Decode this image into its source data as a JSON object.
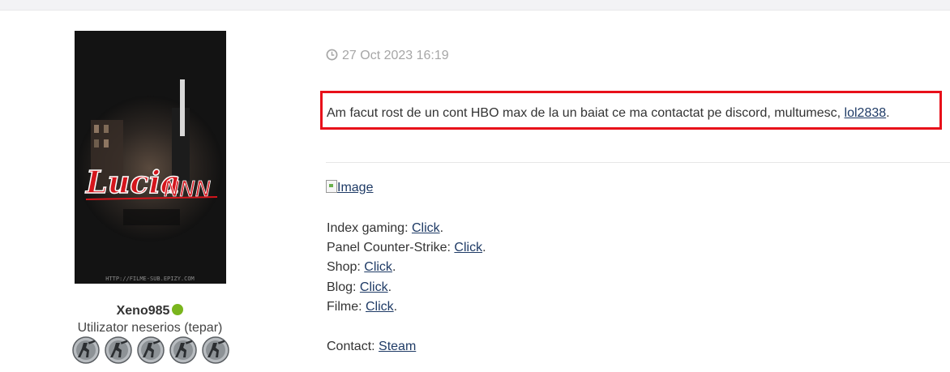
{
  "profile": {
    "avatar_text": "Lucia",
    "avatar_text_2": "NNN",
    "avatar_watermark": "HTTP://FILME-SUB.EPIZY.COM",
    "username": "Xeno985",
    "rank": "Utilizator neserios (tepar)",
    "badge_count": 5,
    "colors": {
      "online": "#7ab51d"
    }
  },
  "post": {
    "date": "27 Oct 2023 16:19",
    "message_prefix": "Am facut rost de un cont HBO max de la un baiat ce ma contactat pe discord, multumesc, ",
    "mention": "lol2838",
    "message_suffix": ".",
    "highlight_color": "#e8101a"
  },
  "signature": {
    "image_alt": "Image",
    "lines": [
      {
        "label": "Index gaming: ",
        "link": "Click",
        "suffix": "."
      },
      {
        "label": "Panel Counter-Strike: ",
        "link": "Click",
        "suffix": "."
      },
      {
        "label": "Shop: ",
        "link": "Click",
        "suffix": "."
      },
      {
        "label": "Blog: ",
        "link": "Click",
        "suffix": "."
      },
      {
        "label": "Filme: ",
        "link": "Click",
        "suffix": "."
      }
    ],
    "contact": {
      "label": "Contact: ",
      "link": "Steam"
    }
  }
}
